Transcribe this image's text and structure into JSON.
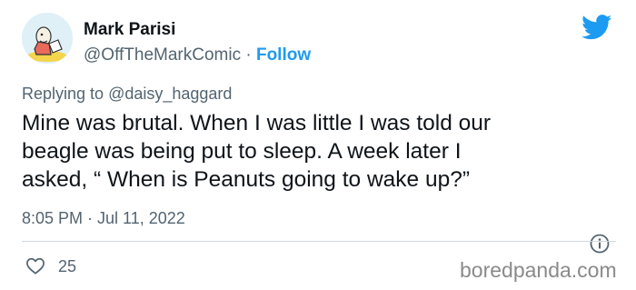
{
  "author": {
    "name": "Mark Parisi",
    "handle": "@OffTheMarkComic",
    "separator": "·",
    "follow_label": "Follow"
  },
  "reply": {
    "prefix": "Replying to",
    "handle": "@daisy_haggard"
  },
  "tweet": {
    "lines": [
      "Mine was brutal. When I was little I was told our",
      "beagle was being put to sleep. A week later I",
      "asked, “ When is Peanuts going to wake up?”"
    ],
    "timestamp": "8:05 PM · Jul 11, 2022"
  },
  "stats": {
    "likes": "25"
  },
  "watermark": "boredpanda.com",
  "icons": [
    "avatar-comic",
    "twitter-bird-icon",
    "info-icon",
    "heart-icon"
  ],
  "colors": {
    "accent": "#1d9bf0",
    "secondary_text": "#536471",
    "primary_text": "#0f1419",
    "divider": "#cfd9de"
  }
}
